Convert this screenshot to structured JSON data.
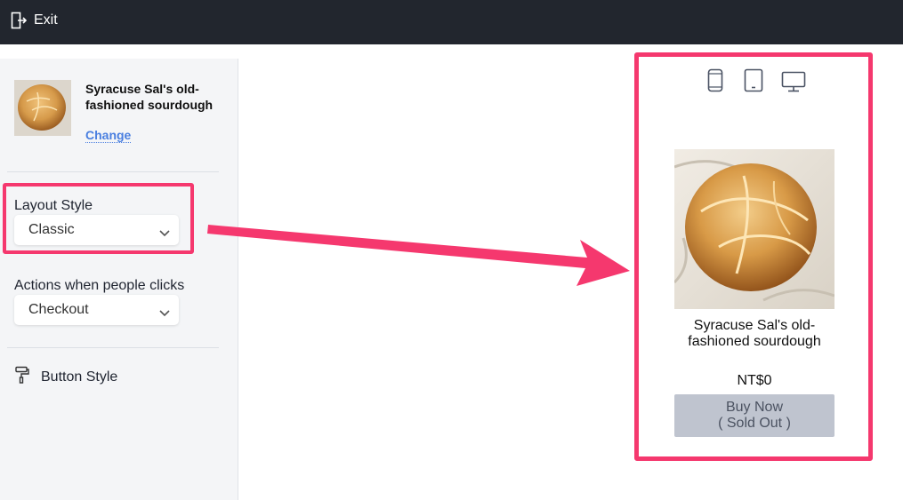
{
  "topbar": {
    "exit_label": "Exit"
  },
  "sidebar": {
    "product_name": "Syracuse Sal's old-fashioned sourdough",
    "change_label": "Change",
    "layout_style": {
      "label": "Layout Style",
      "selected": "Classic"
    },
    "click_action": {
      "label": "Actions when people clicks",
      "selected": "Checkout"
    },
    "button_style_label": "Button Style"
  },
  "device_toggles": [
    "phone-icon",
    "tablet-icon",
    "desktop-icon"
  ],
  "preview": {
    "product_name": "Syracuse Sal's old-fashioned sourdough",
    "price": "NT$0",
    "buy_line1": "Buy Now",
    "buy_line2": "( Sold Out )"
  },
  "colors": {
    "topbar": "#22262e",
    "highlight": "#f5386e",
    "link": "#4a7fe0",
    "disabled_button": "#bfc4cf",
    "sidebar_bg": "#f4f5f7"
  }
}
